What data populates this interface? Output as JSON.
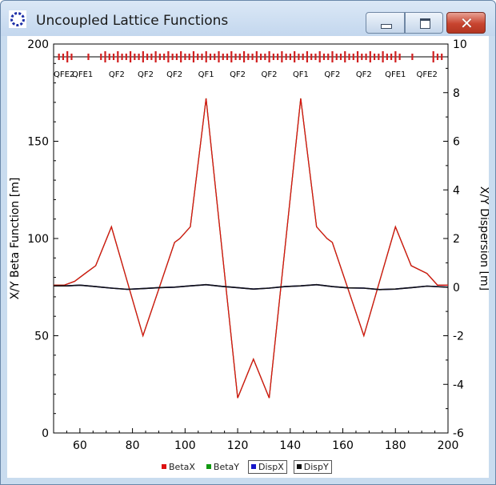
{
  "window": {
    "title": "Uncoupled Lattice Functions",
    "close_glyph": "✕"
  },
  "colors": {
    "betax": "#dd1111",
    "betay": "#119911",
    "dispx": "#1515c8",
    "dispy": "#111111",
    "magnet_red": "#d22020",
    "magnet_blue": "#2a2ad0"
  },
  "chart_data": {
    "type": "line",
    "title": "",
    "xlabel": "",
    "ylabel": "X/Y Beta Function [m]",
    "y2label": "X/Y Dispersion [m]",
    "xlim": [
      50,
      200
    ],
    "ylim": [
      0,
      200
    ],
    "y2lim": [
      -6,
      10
    ],
    "xticks": [
      60,
      80,
      100,
      120,
      140,
      160,
      180,
      200
    ],
    "yticks": [
      0,
      50,
      100,
      150,
      200
    ],
    "y2ticks": [
      -6,
      -4,
      -2,
      0,
      2,
      4,
      6,
      8,
      10
    ],
    "grid": false,
    "legend": "bottom",
    "legend_entries": [
      "BetaX",
      "BetaY",
      "DispX",
      "DispY"
    ],
    "magnet_labels": [
      {
        "x": 54,
        "label": "QFE2"
      },
      {
        "x": 61,
        "label": "QFE1"
      },
      {
        "x": 74,
        "label": "QF2"
      },
      {
        "x": 85,
        "label": "QF2"
      },
      {
        "x": 96,
        "label": "QF2"
      },
      {
        "x": 108,
        "label": "QF1"
      },
      {
        "x": 120,
        "label": "QF2"
      },
      {
        "x": 132,
        "label": "QF2"
      },
      {
        "x": 144,
        "label": "QF1"
      },
      {
        "x": 156,
        "label": "QF2"
      },
      {
        "x": 168,
        "label": "QF2"
      },
      {
        "x": 180,
        "label": "QFE1"
      },
      {
        "x": 192,
        "label": "QFE2"
      }
    ],
    "series": [
      {
        "name": "BetaY",
        "axis": "left",
        "x": [
          50,
          54,
          58,
          62,
          66,
          72,
          78,
          84,
          90,
          96,
          98,
          102,
          108,
          114,
          120,
          126,
          132,
          138,
          144,
          150,
          154,
          156,
          162,
          168,
          174,
          180,
          186,
          192,
          196,
          200
        ],
        "y": [
          76,
          76,
          78,
          82,
          86,
          106,
          78,
          50,
          74,
          98,
          100,
          106,
          172,
          95,
          18,
          38,
          18,
          95,
          172,
          106,
          100,
          98,
          74,
          50,
          78,
          106,
          86,
          82,
          76,
          76
        ]
      },
      {
        "name": "BetaX",
        "axis": "left",
        "x": [
          50,
          54,
          58,
          62,
          66,
          72,
          78,
          84,
          90,
          96,
          98,
          102,
          108,
          114,
          120,
          126,
          132,
          138,
          144,
          150,
          154,
          156,
          162,
          168,
          174,
          180,
          186,
          192,
          196,
          200
        ],
        "y": [
          76,
          76,
          78,
          82,
          86,
          106,
          78,
          50,
          74,
          98,
          100,
          106,
          172,
          95,
          18,
          38,
          18,
          95,
          172,
          106,
          100,
          98,
          74,
          50,
          78,
          106,
          86,
          82,
          76,
          76
        ]
      },
      {
        "name": "DispX",
        "axis": "right",
        "x": [
          50,
          55,
          60,
          66,
          72,
          78,
          84,
          90,
          96,
          102,
          108,
          114,
          120,
          126,
          132,
          138,
          144,
          150,
          156,
          162,
          168,
          174,
          180,
          186,
          192,
          200
        ],
        "y": [
          0.05,
          0.05,
          0.08,
          0.02,
          -0.04,
          -0.09,
          -0.06,
          -0.02,
          0.0,
          0.05,
          0.1,
          0.03,
          -0.02,
          -0.08,
          -0.04,
          0.02,
          0.05,
          0.1,
          0.02,
          -0.03,
          -0.04,
          -0.1,
          -0.08,
          -0.02,
          0.04,
          0.0
        ]
      },
      {
        "name": "DispY",
        "axis": "right",
        "x": [
          50,
          55,
          60,
          66,
          72,
          78,
          84,
          90,
          96,
          102,
          108,
          114,
          120,
          126,
          132,
          138,
          144,
          150,
          156,
          162,
          168,
          174,
          180,
          186,
          192,
          200
        ],
        "y": [
          0.05,
          0.05,
          0.08,
          0.02,
          -0.04,
          -0.09,
          -0.06,
          -0.02,
          0.0,
          0.05,
          0.1,
          0.03,
          -0.02,
          -0.08,
          -0.04,
          0.02,
          0.05,
          0.1,
          0.02,
          -0.03,
          -0.04,
          -0.1,
          -0.08,
          -0.02,
          0.04,
          0.0
        ]
      }
    ]
  }
}
